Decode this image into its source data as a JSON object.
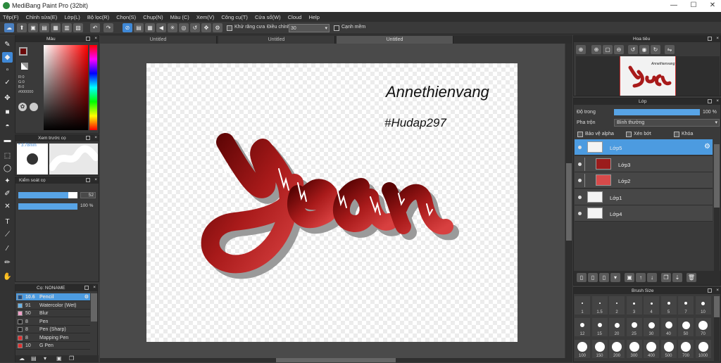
{
  "window": {
    "title": "MediBang Paint Pro (32bit)",
    "minimize": "—",
    "maximize": "☐",
    "close": "✕"
  },
  "menu": [
    "Tệp(F)",
    "Chỉnh sửa(E)",
    "Lớp(L)",
    "Bộ lọc(R)",
    "Chọn(S)",
    "Chụp(N)",
    "Màu (C)",
    "Xem(V)",
    "Công cụ(T)",
    "Cửa sổ(W)",
    "Cloud",
    "Help"
  ],
  "toolbar": {
    "antialias_label": "Khử răng cưa",
    "adjust_label": "Điều chỉnh",
    "adjust_value": "30",
    "edge_label": "Cạnh mềm"
  },
  "tabs": [
    "Untitled",
    "Untitled",
    "Untitled"
  ],
  "color_panel": {
    "title": "Màu",
    "r": "R:0",
    "g": "G:0",
    "b": "B:0",
    "hex": "#000000",
    "main_color": "#6b0a0a"
  },
  "brush_preview": {
    "title": "Xem trước cọ",
    "size": "3.78mm"
  },
  "brush_control": {
    "title": "Kiểm soát cọ",
    "size_value": "52",
    "opacity_value": "100 %",
    "size_fraction": 0.85,
    "opacity_fraction": 1.0
  },
  "brush_list": {
    "title": "Cọ: NONAME",
    "items": [
      {
        "size": "10.6",
        "name": "Pencil",
        "color": "#1a4f8a",
        "selected": true
      },
      {
        "size": "91",
        "name": "Watercolor (Wet)",
        "color": "#66b3e8",
        "selected": false
      },
      {
        "size": "50",
        "name": "Blur",
        "color": "#f2a0c8",
        "selected": false
      },
      {
        "size": "8",
        "name": "Pen",
        "color": "#222222",
        "selected": false
      },
      {
        "size": "8",
        "name": "Pen (Sharp)",
        "color": "#222222",
        "selected": false
      },
      {
        "size": "8",
        "name": "Mapping Pen",
        "color": "#e03030",
        "selected": false
      },
      {
        "size": "10",
        "name": "G Pen",
        "color": "#e03030",
        "selected": false
      }
    ]
  },
  "navigator": {
    "title": "Hoa tiêu"
  },
  "layers": {
    "title": "Lớp",
    "opacity_label": "Độ trong",
    "opacity_value": "100 %",
    "blend_label": "Pha trộn",
    "blend_value": "Bình thường",
    "protect_alpha": "Bảo vệ alpha",
    "clipping": "Xén bớt",
    "lock": "Khóa",
    "items": [
      {
        "name": "Lớp5",
        "selected": true,
        "indent": false
      },
      {
        "name": "Lớp3",
        "selected": false,
        "indent": true
      },
      {
        "name": "Lớp2",
        "selected": false,
        "indent": true
      },
      {
        "name": "Lớp1",
        "selected": false,
        "indent": false
      },
      {
        "name": "Lớp4",
        "selected": false,
        "indent": false
      }
    ]
  },
  "brush_size": {
    "title": "Brush Size",
    "rows": [
      [
        "1",
        "1.5",
        "2",
        "3",
        "4",
        "5",
        "7",
        "10"
      ],
      [
        "12",
        "15",
        "20",
        "25",
        "30",
        "40",
        "50",
        "70"
      ],
      [
        "100",
        "150",
        "200",
        "300",
        "400",
        "500",
        "700",
        "1000"
      ]
    ]
  },
  "artwork": {
    "word": "Year",
    "author": "Annethienvang",
    "hashtag": "#Hudap297",
    "color": "#9e1414"
  }
}
